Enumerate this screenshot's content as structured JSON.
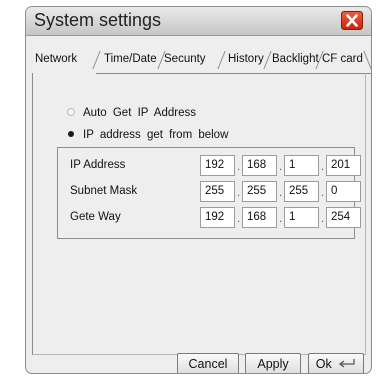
{
  "window": {
    "title": "System settings"
  },
  "tabs": [
    {
      "label": "Network",
      "active": true
    },
    {
      "label": "Time/Date"
    },
    {
      "label": "Secunty"
    },
    {
      "label": "History"
    },
    {
      "label": "Backlight"
    },
    {
      "label": "CF card"
    }
  ],
  "network": {
    "auto_option": {
      "label": "Auto  Get  IP  Address",
      "selected": false
    },
    "manual_option": {
      "label": "IP  address  get  from  below",
      "selected": true
    },
    "fields": [
      {
        "label": "IP Address",
        "octets": [
          "192",
          "168",
          "1",
          "201"
        ]
      },
      {
        "label": "Subnet Mask",
        "octets": [
          "255",
          "255",
          "255",
          "0"
        ]
      },
      {
        "label": "Gete Way",
        "octets": [
          "192",
          "168",
          "1",
          "254"
        ]
      }
    ],
    "separator": "."
  },
  "buttons": {
    "cancel": "Cancel",
    "apply": "Apply",
    "ok": "Ok"
  },
  "colors": {
    "close_button": "#d93a1c",
    "background": "#eeeeee"
  }
}
